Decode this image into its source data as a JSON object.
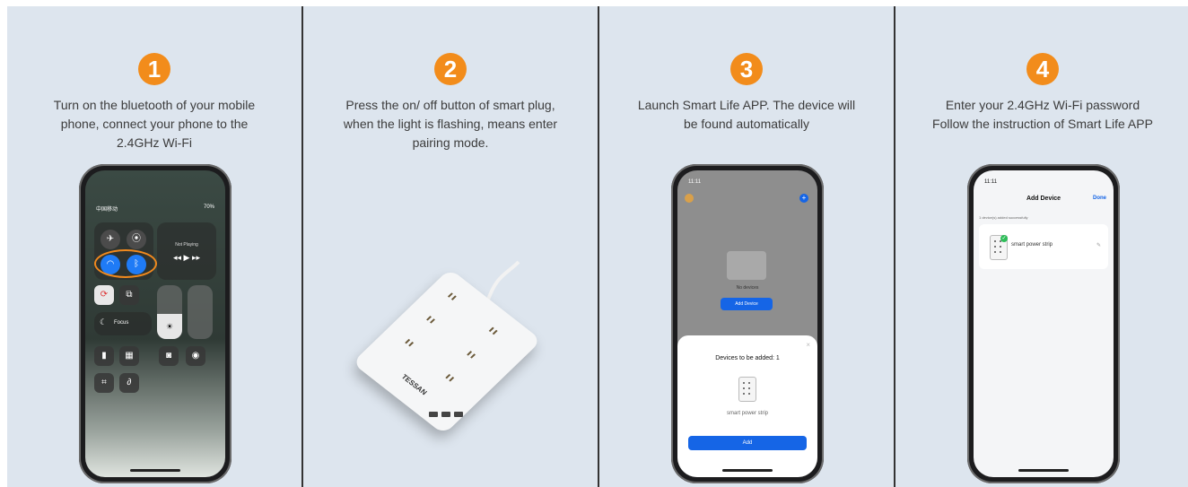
{
  "steps": [
    {
      "number": "1",
      "caption_lines": [
        "Turn on the bluetooth of your mobile",
        "phone, connect your phone to the",
        "2.4GHz Wi-Fi"
      ]
    },
    {
      "number": "2",
      "caption_lines": [
        "Press the on/ off button of smart plug,",
        "when the light is flashing, means enter",
        "pairing mode."
      ]
    },
    {
      "number": "3",
      "caption_lines": [
        "Launch Smart Life APP. The device will",
        "be found automatically"
      ]
    },
    {
      "number": "4",
      "caption_lines": [
        "Enter your 2.4GHz Wi-Fi password",
        "Follow the instruction of Smart Life APP"
      ]
    }
  ],
  "phone1": {
    "carrier": "中国移动",
    "battery": "70%",
    "now_playing": "Not Playing",
    "focus": "Focus"
  },
  "phone3": {
    "time": "11:11",
    "no_devices": "No devices",
    "add_device": "Add Device",
    "sheet_title": "Devices to be added: 1",
    "device_name": "smart power strip",
    "add_button": "Add"
  },
  "phone4": {
    "time": "11:11",
    "title": "Add Device",
    "done": "Done",
    "success_note": "1 device(s) added successfully",
    "device_name": "smart power strip"
  },
  "product": {
    "brand": "TESSAN"
  },
  "colors": {
    "badge": "#f28c1b",
    "accent_blue": "#1565e6",
    "panel_bg": "#dde5ee"
  }
}
